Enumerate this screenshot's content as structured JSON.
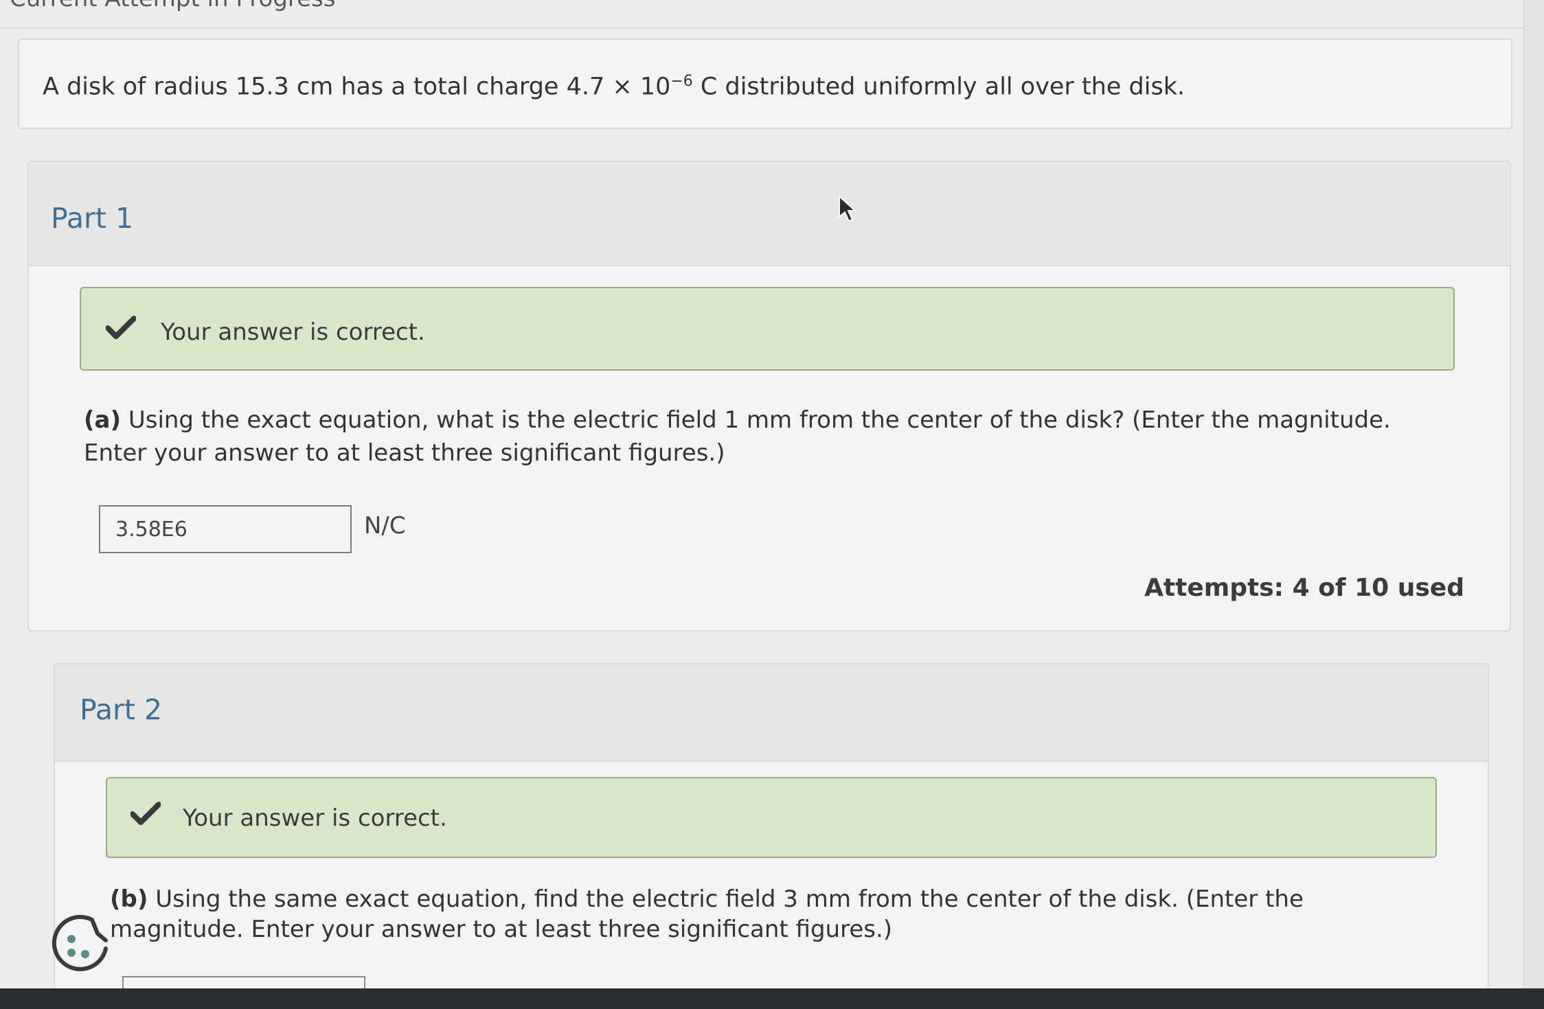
{
  "header": {
    "title": "Current Attempt in Progress"
  },
  "question": {
    "text_before": "A disk of radius 15.3 cm has a total charge 4.7 × 10",
    "exponent": "−6",
    "text_after": " C distributed uniformly all over the disk."
  },
  "part1": {
    "title": "Part 1",
    "feedback": "Your answer is correct.",
    "prompt_label": "(a)",
    "prompt_text": " Using the exact equation, what is the electric field 1 mm from the center of the disk? (Enter the magnitude. Enter your answer to at least three significant figures.)",
    "answer_value": "3.58E6",
    "unit": "N/C",
    "attempts": "Attempts: 4 of 10 used"
  },
  "part2": {
    "title": "Part 2",
    "feedback": "Your answer is correct.",
    "prompt_label": "(b)",
    "prompt_text": " Using the same exact equation, find the electric field 3 mm from the center of the disk. (Enter the magnitude. Enter your answer to at least three significant figures.)"
  },
  "colors": {
    "part_title": "#3f6f93",
    "success_bg": "#d9e6c9",
    "success_border": "#98a98a",
    "check": "#3a3a3a"
  },
  "icons": {
    "check": "check-icon",
    "cursor": "cursor-icon",
    "help": "help-icon"
  }
}
